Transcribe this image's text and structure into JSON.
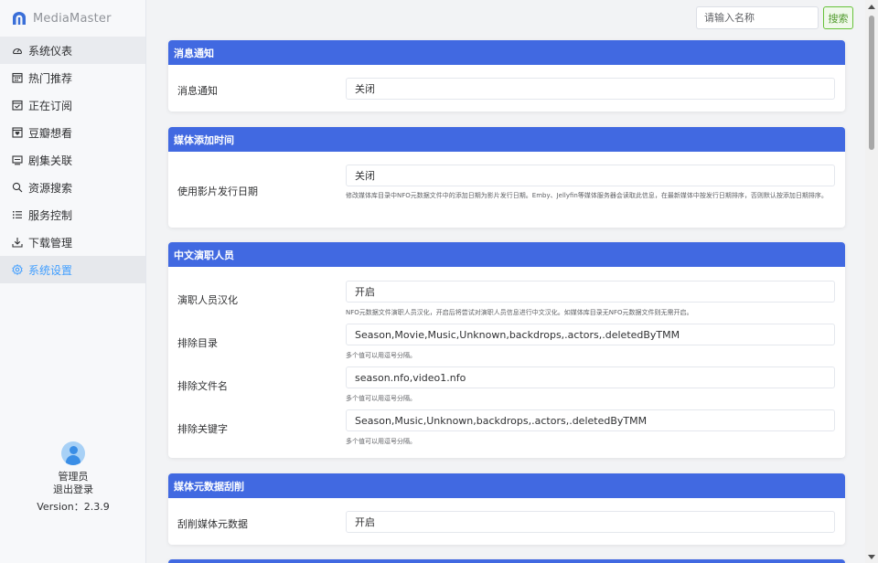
{
  "app": {
    "name": "MediaMaster"
  },
  "sidebar": {
    "items": [
      {
        "label": "系统仪表",
        "icon": "gauge-icon"
      },
      {
        "label": "热门推荐",
        "icon": "calendar-grid-icon"
      },
      {
        "label": "正在订阅",
        "icon": "calendar-check-icon"
      },
      {
        "label": "豆瓣想看",
        "icon": "heart-box-icon"
      },
      {
        "label": "剧集关联",
        "icon": "monitor-icon"
      },
      {
        "label": "资源搜索",
        "icon": "search-icon"
      },
      {
        "label": "服务控制",
        "icon": "list-icon"
      },
      {
        "label": "下载管理",
        "icon": "download-icon"
      },
      {
        "label": "系统设置",
        "icon": "gear-icon"
      }
    ],
    "active_index": 8
  },
  "user": {
    "name": "管理员",
    "logout": "退出登录",
    "version": "Version：2.3.9"
  },
  "search": {
    "placeholder": "请输入名称",
    "button": "搜索"
  },
  "sections": {
    "notify": {
      "title": "消息通知",
      "rows": [
        {
          "label": "消息通知",
          "value": "关闭"
        }
      ]
    },
    "addtime": {
      "title": "媒体添加时间",
      "rows": [
        {
          "label": "使用影片发行日期",
          "value": "关闭",
          "hint": "修改媒体库目录中NFO元数据文件中的添加日期为影片发行日期。Emby、Jellyfin等媒体服务器会读取此信息，在最新媒体中按发行日期排序，否则默认按添加日期排序。"
        }
      ]
    },
    "actors": {
      "title": "中文演职人员",
      "rows": [
        {
          "label": "演职人员汉化",
          "value": "开启",
          "hint": "NFO元数据文件演职人员汉化，开启后将尝试对演职人员信息进行中文汉化。如媒体库目录无NFO元数据文件则无需开启。"
        },
        {
          "label": "排除目录",
          "value": "Season,Movie,Music,Unknown,backdrops,.actors,.deletedByTMM",
          "hint": "多个值可以用逗号分隔。"
        },
        {
          "label": "排除文件名",
          "value": "season.nfo,video1.nfo",
          "hint": "多个值可以用逗号分隔。"
        },
        {
          "label": "排除关键字",
          "value": "Season,Music,Unknown,backdrops,.actors,.deletedByTMM",
          "hint": "多个值可以用逗号分隔。"
        }
      ]
    },
    "scrape": {
      "title": "媒体元数据刮削",
      "rows": [
        {
          "label": "刮削媒体元数据",
          "value": "开启"
        }
      ]
    }
  },
  "colors": {
    "header": "#4169e1",
    "active": "#409eff",
    "success": "#67c23a"
  }
}
